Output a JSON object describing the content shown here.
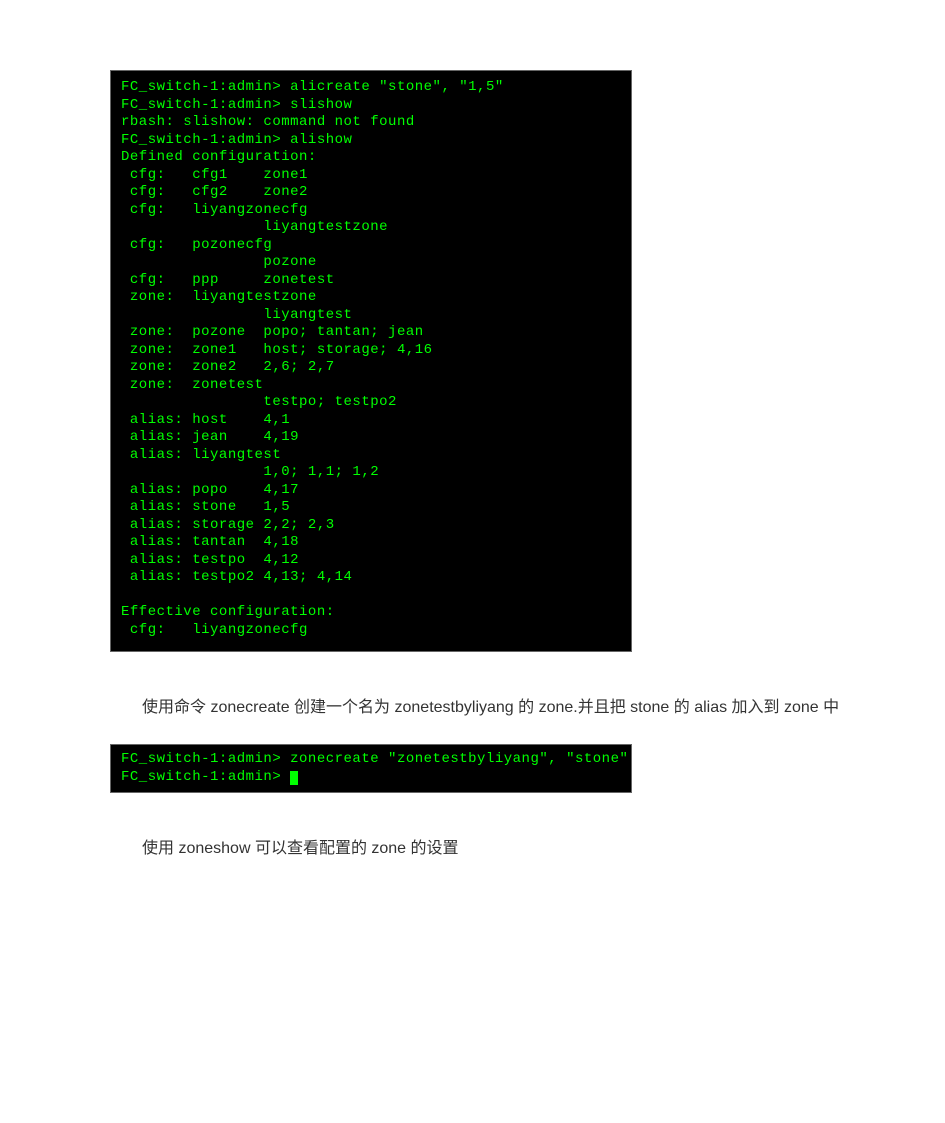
{
  "terminal1_lines": [
    "FC_switch-1:admin> alicreate \"stone\", \"1,5\"",
    "FC_switch-1:admin> slishow",
    "rbash: slishow: command not found",
    "FC_switch-1:admin> alishow",
    "Defined configuration:",
    " cfg:   cfg1    zone1",
    " cfg:   cfg2    zone2",
    " cfg:   liyangzonecfg",
    "                liyangtestzone",
    " cfg:   pozonecfg",
    "                pozone",
    " cfg:   ppp     zonetest",
    " zone:  liyangtestzone",
    "                liyangtest",
    " zone:  pozone  popo; tantan; jean",
    " zone:  zone1   host; storage; 4,16",
    " zone:  zone2   2,6; 2,7",
    " zone:  zonetest",
    "                testpo; testpo2",
    " alias: host    4,1",
    " alias: jean    4,19",
    " alias: liyangtest",
    "                1,0; 1,1; 1,2",
    " alias: popo    4,17",
    " alias: stone   1,5",
    " alias: storage 2,2; 2,3",
    " alias: tantan  4,18",
    " alias: testpo  4,12",
    " alias: testpo2 4,13; 4,14",
    "",
    "Effective configuration:",
    " cfg:   liyangzonecfg"
  ],
  "paragraph1": "使用命令 zonecreate 创建一个名为 zonetestbyliyang 的 zone.并且把 stone 的 alias 加入到 zone  中",
  "terminal2_lines": [
    "FC_switch-1:admin> zonecreate \"zonetestbyliyang\", \"stone\"",
    "FC_switch-1:admin> "
  ],
  "paragraph2": "使用 zoneshow 可以查看配置的 zone  的设置"
}
